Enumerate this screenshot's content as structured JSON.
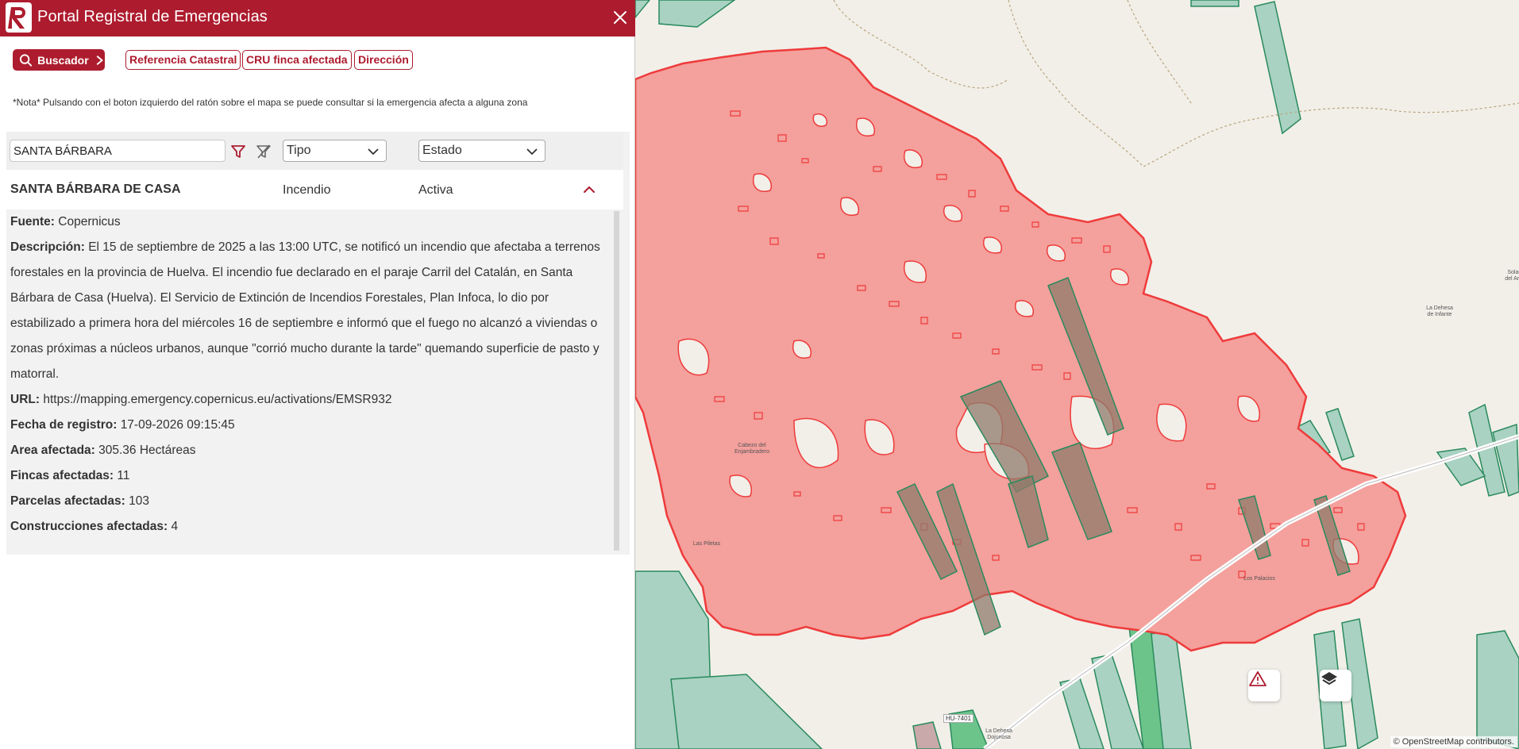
{
  "header": {
    "title": "Portal Registral de Emergencias"
  },
  "toolbar": {
    "search_label": "Buscador",
    "buttons": [
      "Referencia Catastral",
      "CRU finca afectada",
      "Dirección"
    ]
  },
  "note": "*Nota* Pulsando con el boton izquierdo del ratón sobre el mapa se puede consultar si la emergencia afecta a alguna zona",
  "filters": {
    "search_value": "SANTA BÁRBARA",
    "type_placeholder": "Tipo",
    "status_placeholder": "Estado"
  },
  "result": {
    "name": "SANTA BÁRBARA DE CASA",
    "type": "Incendio",
    "status": "Activa",
    "details": {
      "fuente_label": "Fuente:",
      "fuente": "Copernicus",
      "descripcion_label": "Descripción:",
      "descripcion": "El 15 de septiembre de 2025 a las 13:00 UTC, se notificó un incendio que afectaba a terrenos forestales en la provincia de Huelva. El incendio fue declarado en el paraje Carril del Catalán, en Santa Bárbara de Casa (Huelva). El Servicio de Extinción de Incendios Forestales, Plan Infoca, lo dio por estabilizado a primera hora del miércoles 16 de septiembre e informó que el fuego no alcanzó a viviendas o zonas próximas a núcleos urbanos, aunque \"corrió mucho durante la tarde\" quemando superficie de pasto y matorral.",
      "url_label": "URL:",
      "url": "https://mapping.emergency.copernicus.eu/activations/EMSR932",
      "fecha_label": "Fecha de registro:",
      "fecha": "17-09-2026 09:15:45",
      "area_label": "Area afectada:",
      "area": "305.36 Hectáreas",
      "fincas_label": "Fincas afectadas:",
      "fincas": "11",
      "parcelas_label": "Parcelas afectadas:",
      "parcelas": "103",
      "construcciones_label": "Construcciones afectadas:",
      "construcciones": "4"
    }
  },
  "map": {
    "labels": {
      "solanas": "Solanas del Arroyo",
      "dehesa_infante": "La Dehesa de Infante",
      "cabezo": "Cabezo del Enjambradero",
      "piletas": "Las Piletas",
      "palacios": "Los Palacios",
      "dehesa_dojunosa": "La Dehesa Dojunosa",
      "road": "HU-7401"
    },
    "attribution": "© OpenStreetMap contributors.",
    "colors": {
      "burn_fill": "#f4a09c",
      "burn_stroke": "#ee3b3b",
      "parcel_fill": "#a9d2c3",
      "parcel_stroke": "#2a8a5c"
    },
    "icons": [
      "warning-icon",
      "layers-icon"
    ]
  },
  "colors": {
    "brand": "#ad1c2e"
  }
}
